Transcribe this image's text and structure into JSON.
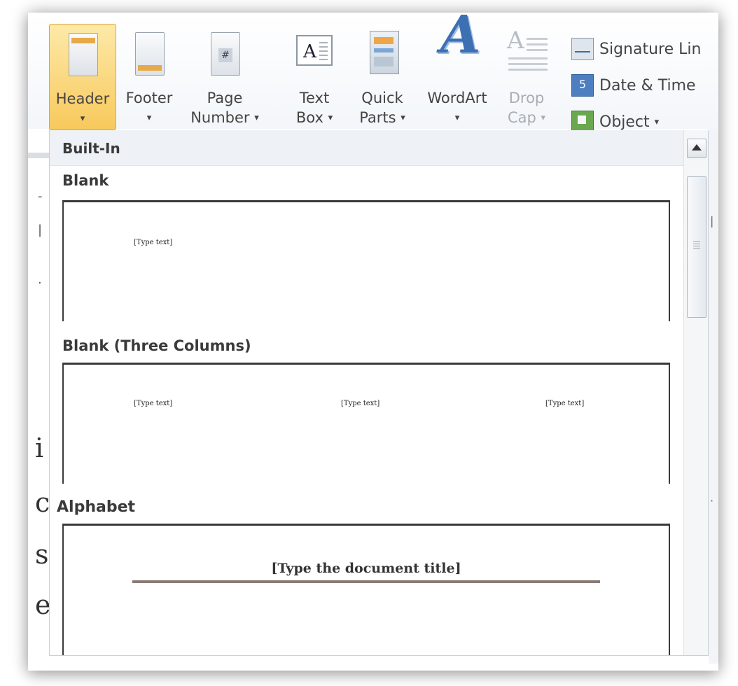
{
  "ribbon": {
    "header": {
      "label": "Header",
      "caret": "▾"
    },
    "footer": {
      "label": "Footer",
      "caret": "▾"
    },
    "page_number": {
      "label1": "Page",
      "label2": "Number",
      "caret": "▾"
    },
    "text_box": {
      "label1": "Text",
      "label2": "Box",
      "caret": "▾",
      "icon_glyph": "A"
    },
    "quick_parts": {
      "label1": "Quick",
      "label2": "Parts",
      "caret": "▾"
    },
    "wordart": {
      "label": "WordArt",
      "caret": "▾",
      "icon_glyph": "A"
    },
    "drop_cap": {
      "label1": "Drop",
      "label2": "Cap",
      "caret": "▾",
      "icon_glyph": "A"
    },
    "signature_line": {
      "label": "Signature Lin"
    },
    "date_time": {
      "label": "Date & Time"
    },
    "object": {
      "label": "Object",
      "caret": "▾"
    },
    "page_number_icon_glyph": "#",
    "date_icon_glyph": "5"
  },
  "gallery": {
    "group_header": "Built-In",
    "items": [
      {
        "title": "Blank",
        "placeholders": [
          "[Type text]"
        ]
      },
      {
        "title": "Blank (Three Columns)",
        "placeholders": [
          "[Type text]",
          "[Type text]",
          "[Type text]"
        ]
      },
      {
        "title": "Alphabet",
        "doc_title_placeholder": "[Type the document title]"
      }
    ]
  },
  "document_behind": {
    "chars": [
      "i",
      "c",
      "s",
      "e"
    ],
    "marks": [
      "-",
      "·",
      "|",
      "·"
    ]
  },
  "colors": {
    "active_button": "#f8c95c",
    "wordart_blue": "#3d6fb3",
    "alphabet_rule": "#8a7a76"
  }
}
